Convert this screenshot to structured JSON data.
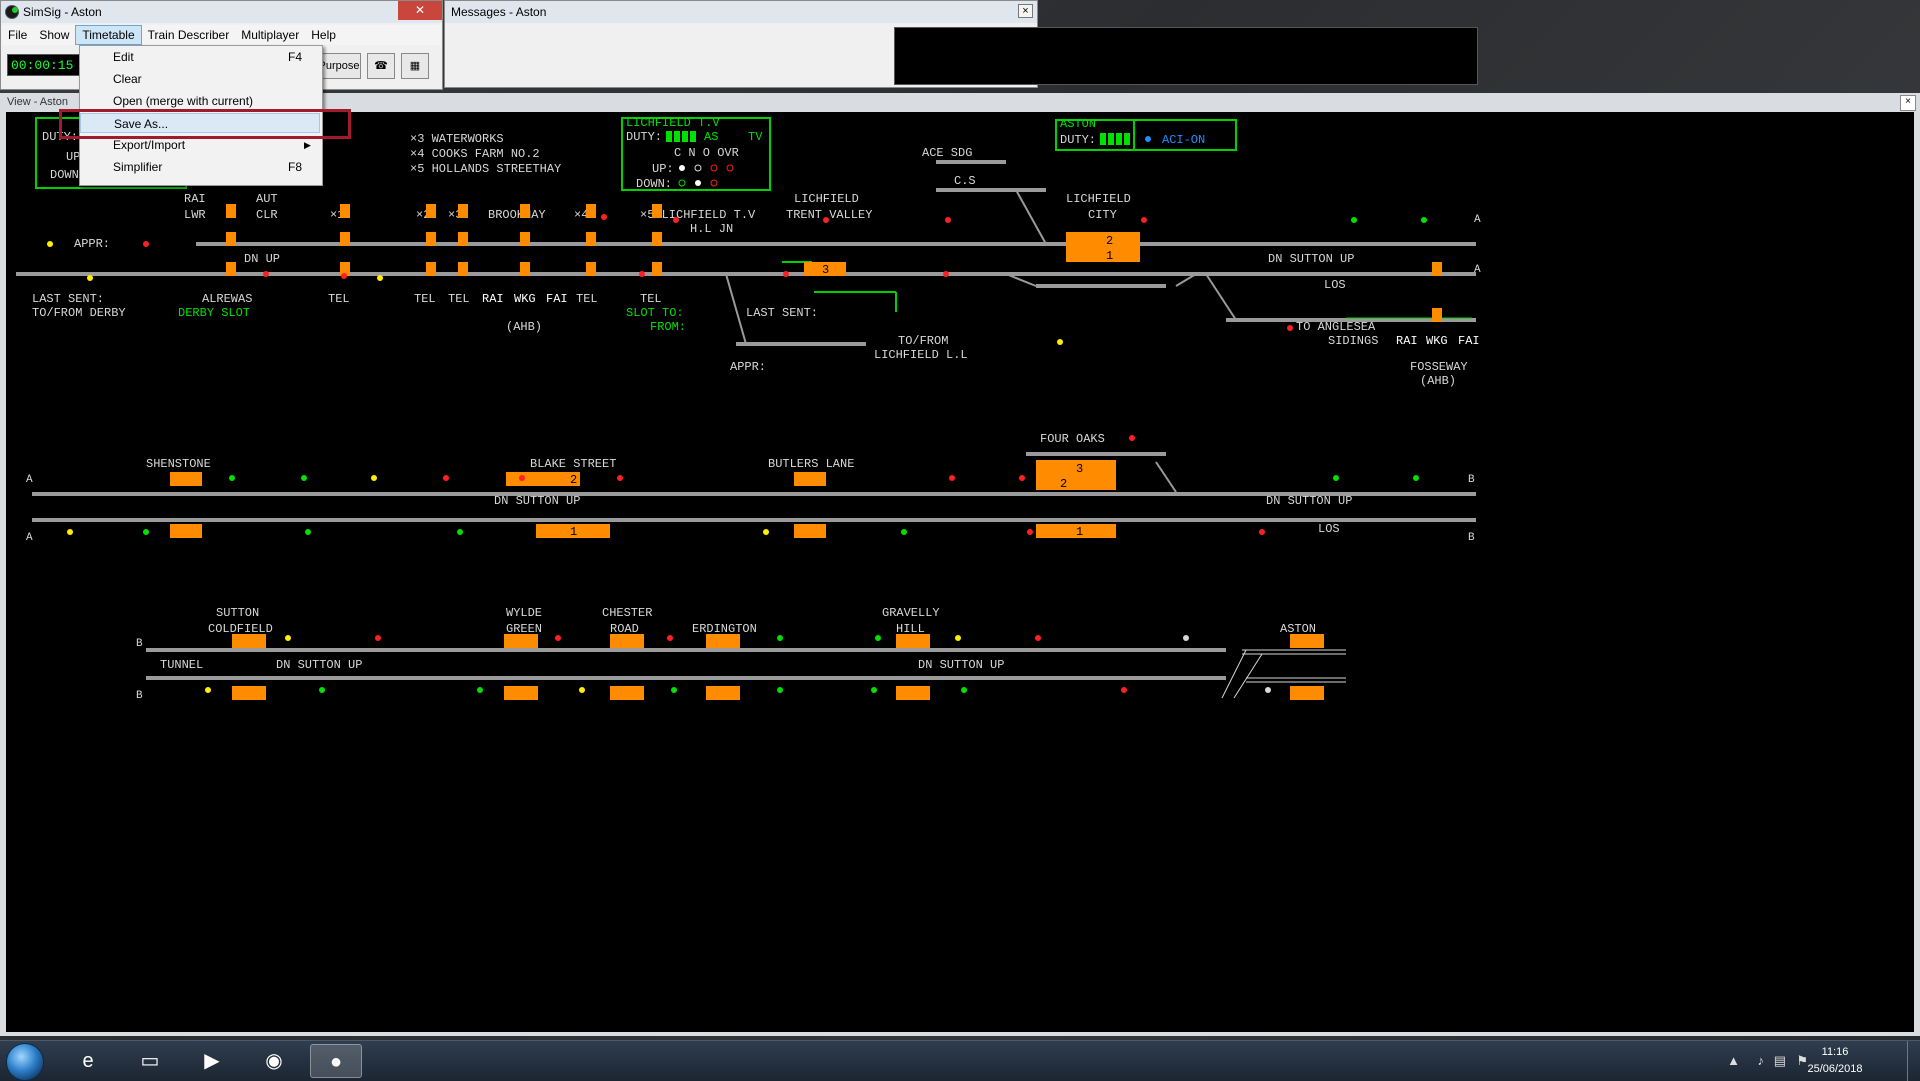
{
  "main_window": {
    "title": "SimSig - Aston",
    "clock": "00:00:15",
    "toolbar_button_purpose": "Purpose"
  },
  "menu": [
    "File",
    "Show",
    "Timetable",
    "Train Describer",
    "Multiplayer",
    "Help"
  ],
  "timetable_menu": [
    {
      "label": "Edit",
      "shortcut": "F4"
    },
    {
      "label": "Clear",
      "shortcut": ""
    },
    {
      "label": "Open (merge with current)",
      "shortcut": ""
    },
    {
      "label": "Save As...",
      "shortcut": ""
    },
    {
      "label": "Export/Import",
      "shortcut": ""
    },
    {
      "label": "Simplifier",
      "shortcut": "F8"
    }
  ],
  "messages_window": {
    "title": "Messages - Aston"
  },
  "view_window": {
    "title": "View - Aston"
  },
  "panel": {
    "boxes": {
      "alrewas": {
        "lines": [
          "DUTY:",
          "UP:",
          "DOWN:"
        ]
      },
      "lichfield_tv": {
        "title": "LICHFIELD T.V",
        "lines": [
          "DUTY:",
          "AS",
          "TV",
          "C N O OVR",
          "UP:",
          "DOWN:"
        ]
      },
      "aston": {
        "title": "ASTON",
        "lines": [
          "DUTY:",
          "ACI-ON"
        ]
      }
    },
    "top_labels": [
      "×3 WATERWORKS",
      "×4 COOKS FARM NO.2",
      "×5 HOLLANDS STREETHAY",
      "ACE SDG",
      "C.S",
      "LICHFIELD",
      "TRENT VALLEY",
      "LICHFIELD",
      "CITY",
      "RAI",
      "LWR",
      "AUT",
      "CLR",
      "APPR:",
      "×1",
      "×2",
      "×3",
      "BROOKHAY",
      "×4",
      "×5 LICHFIELD T.V",
      "H.L JN",
      "DN UP",
      "DN SUTTON UP",
      "LAST SENT:",
      "TO/FROM DERBY",
      "ALREWAS",
      "DERBY SLOT",
      "TEL",
      "TEL",
      "TEL",
      "RAI",
      "WKG",
      "FAI",
      "TEL",
      "(AHB)",
      "TEL",
      "SLOT TO:",
      "FROM:",
      "LAST SENT:",
      "APPR:",
      "TO/FROM",
      "LICHFIELD L.L",
      "LOS",
      "TO ANGLESEA",
      "SIDINGS",
      "RAI",
      "WKG",
      "FAI",
      "FOSSEWAY",
      "(AHB)"
    ],
    "mid_labels": [
      "SHENSTONE",
      "BLAKE STREET",
      "BUTLERS LANE",
      "FOUR OAKS",
      "DN SUTTON UP",
      "DN SUTTON UP",
      "LOS"
    ],
    "bottom_labels": [
      "SUTTON",
      "COLDFIELD",
      "TUNNEL",
      "DN SUTTON UP",
      "WYLDE",
      "GREEN",
      "CHESTER",
      "ROAD",
      "ERDINGTON",
      "GRAVELLY",
      "HILL",
      "DN SUTTON UP",
      "ASTON"
    ],
    "berth_numbers": [
      "2",
      "1",
      "3",
      "2",
      "3",
      "2",
      "1",
      "1"
    ],
    "colors": {
      "track": "#9a9a9a",
      "berth": "#ff8c00",
      "text": "#d8d8d8",
      "box": "#00d000",
      "signal_red": "#ff2020",
      "signal_green": "#00e000",
      "signal_yellow": "#ffee00",
      "oa_blue": "#1e90ff"
    }
  },
  "taskbar": {
    "time": "11:16",
    "date": "25/06/2018",
    "apps": [
      "ie-icon",
      "explorer-icon",
      "media-icon",
      "firefox-icon",
      "simsig-icon"
    ]
  }
}
